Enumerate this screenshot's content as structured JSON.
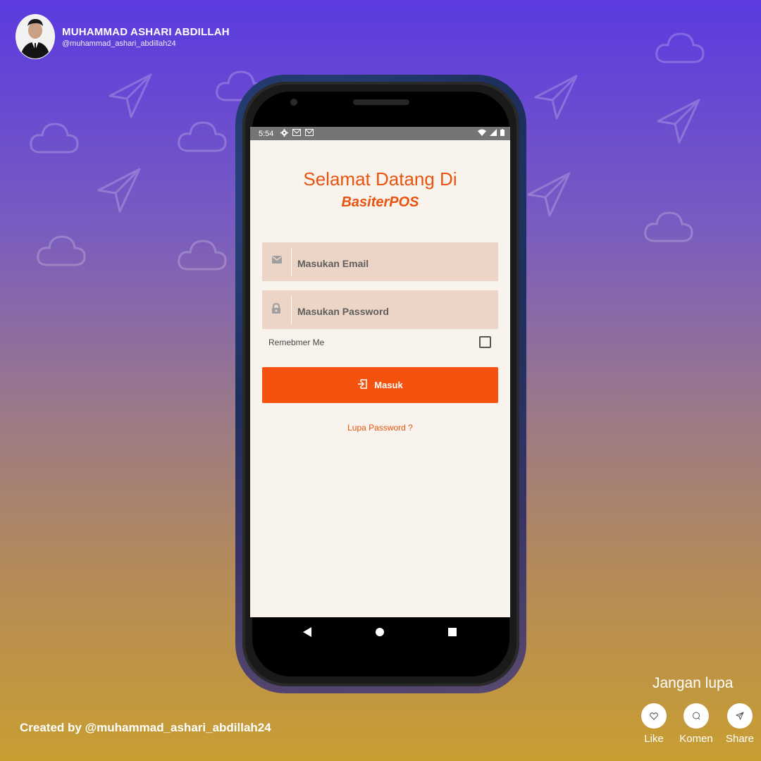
{
  "author": {
    "name": "MUHAMMAD ASHARI ABDILLAH",
    "handle": "@muhammad_ashari_abdillah24"
  },
  "status_bar": {
    "time": "5:54",
    "left_icons": [
      "settings-icon",
      "gmail-icon",
      "gmail-icon"
    ],
    "right_icons": [
      "wifi-icon",
      "signal-icon",
      "battery-icon"
    ]
  },
  "app": {
    "welcome_title": "Selamat Datang Di",
    "brand": "BasiterPOS",
    "email_placeholder": "Masukan Email",
    "password_placeholder": "Masukan Password",
    "remember_label": "Remebmer Me",
    "remember_checked": false,
    "login_button": "Masuk",
    "forgot_password": "Lupa Password ?"
  },
  "footer": {
    "created_by": "Created by @muhammad_ashari_abdillah24",
    "reminder": "Jangan lupa",
    "actions": [
      {
        "label": "Like",
        "icon": "heart-icon"
      },
      {
        "label": "Komen",
        "icon": "comment-icon"
      },
      {
        "label": "Share",
        "icon": "send-icon"
      }
    ]
  },
  "colors": {
    "accent": "#f5520f",
    "input_bg": "#ecd4c7",
    "screen_bg": "#f8f3ec"
  }
}
